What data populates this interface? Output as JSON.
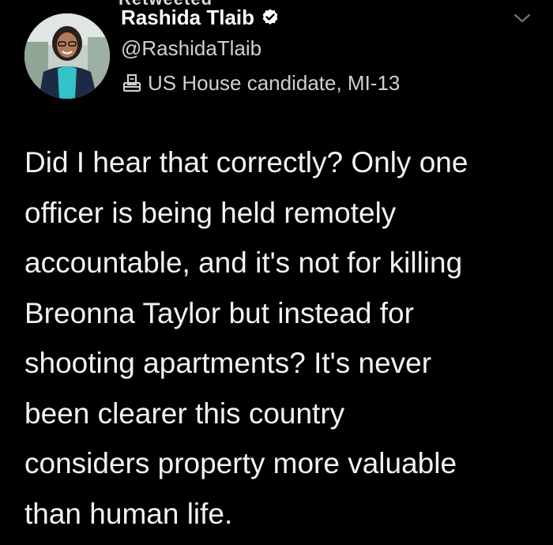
{
  "tweet": {
    "above_cut_text": "Retweeted",
    "author": {
      "display_name": "Rashida Tlaib",
      "handle": "@RashidaTlaib",
      "label": "US House candidate, MI-13",
      "label_icon": "ballot-box-icon",
      "verified": true,
      "verified_icon": "verified-badge-icon"
    },
    "menu_icon": "chevron-down-icon",
    "text_lines": [
      "Did I hear that correctly? Only one",
      "officer is being held remotely",
      "accountable, and it's not for killing",
      "Breonna Taylor but instead for",
      "shooting apartments? It's never",
      "been clearer this country",
      "considers property more valuable",
      "than human life."
    ]
  },
  "colors": {
    "background": "#000000",
    "text_primary": "#ffffff",
    "text_secondary": "#d0d0d0",
    "chevron": "#6e767d"
  }
}
